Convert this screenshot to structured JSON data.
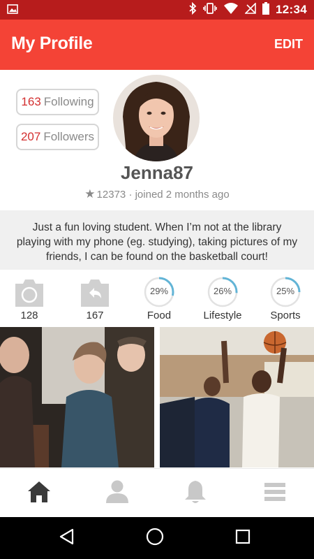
{
  "status_bar": {
    "time": "12:34",
    "icons": [
      "image-icon",
      "bluetooth-icon",
      "vibrate-icon",
      "wifi-icon",
      "no-signal-icon",
      "battery-icon"
    ]
  },
  "header": {
    "title": "My Profile",
    "edit_label": "EDIT",
    "accent_color": "#f44336",
    "status_color": "#b71c1c"
  },
  "profile": {
    "following_count": "163",
    "following_label": "Following",
    "followers_count": "207",
    "followers_label": "Followers",
    "username": "Jenna87",
    "points": "12373",
    "joined": "· joined 2 months ago",
    "bio": "Just a fun loving student. When I’m not at the library playing with my phone (eg. studying), taking pictures of my friends, I can be found on the basketball court!"
  },
  "stats": {
    "photos_count": "128",
    "shares_count": "167",
    "categories": [
      {
        "label": "Food",
        "percent_text": "29%",
        "value": 0.29
      },
      {
        "label": "Lifestyle",
        "percent_text": "26%",
        "value": 0.26
      },
      {
        "label": "Sports",
        "percent_text": "25%",
        "value": 0.25
      }
    ]
  },
  "bottom_nav": {
    "items": [
      "home-icon",
      "profile-icon",
      "notifications-icon",
      "menu-icon"
    ],
    "active": "home-icon"
  },
  "system_nav": {
    "items": [
      "back-icon",
      "home-circle-icon",
      "recents-icon"
    ]
  }
}
